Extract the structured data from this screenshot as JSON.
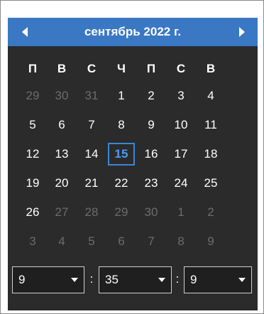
{
  "header": {
    "title": "сентябрь 2022 г.",
    "prev_icon": "triangle-left-icon",
    "next_icon": "triangle-right-icon"
  },
  "weekdays": [
    "П",
    "В",
    "С",
    "Ч",
    "П",
    "С",
    "В"
  ],
  "weeks": [
    [
      {
        "d": "29",
        "o": true
      },
      {
        "d": "30",
        "o": true
      },
      {
        "d": "31",
        "o": true
      },
      {
        "d": "1"
      },
      {
        "d": "2"
      },
      {
        "d": "3"
      },
      {
        "d": "4"
      }
    ],
    [
      {
        "d": "5"
      },
      {
        "d": "6"
      },
      {
        "d": "7"
      },
      {
        "d": "8"
      },
      {
        "d": "9"
      },
      {
        "d": "10"
      },
      {
        "d": "11"
      }
    ],
    [
      {
        "d": "12"
      },
      {
        "d": "13"
      },
      {
        "d": "14"
      },
      {
        "d": "15",
        "today": true
      },
      {
        "d": "16"
      },
      {
        "d": "17"
      },
      {
        "d": "18"
      }
    ],
    [
      {
        "d": "19"
      },
      {
        "d": "20"
      },
      {
        "d": "21"
      },
      {
        "d": "22"
      },
      {
        "d": "23"
      },
      {
        "d": "24"
      },
      {
        "d": "25"
      }
    ],
    [
      {
        "d": "26"
      },
      {
        "d": "27",
        "o": true
      },
      {
        "d": "28",
        "o": true
      },
      {
        "d": "29",
        "o": true
      },
      {
        "d": "30",
        "o": true
      },
      {
        "d": "1",
        "o": true
      },
      {
        "d": "2",
        "o": true
      }
    ],
    [
      {
        "d": "3",
        "o": true
      },
      {
        "d": "4",
        "o": true
      },
      {
        "d": "5",
        "o": true
      },
      {
        "d": "6",
        "o": true
      },
      {
        "d": "7",
        "o": true
      },
      {
        "d": "8",
        "o": true
      },
      {
        "d": "9",
        "o": true
      }
    ]
  ],
  "time": {
    "hour": "9",
    "minute": "35",
    "third": "9",
    "separator": ":"
  },
  "colors": {
    "header_bg": "#3b78c4",
    "panel_bg": "#2b2b2b",
    "today_border": "#3d86d6",
    "today_text": "#4e9bf0",
    "other_month_text": "#6c6c6c"
  }
}
